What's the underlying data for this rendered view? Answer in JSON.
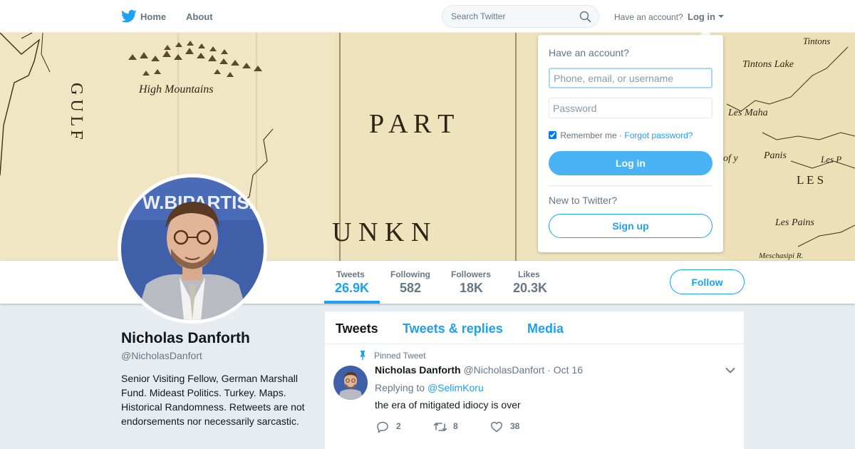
{
  "nav": {
    "logo_icon": "twitter-bird-icon",
    "home_label": "Home",
    "about_label": "About",
    "search_placeholder": "Search Twitter",
    "have_account_label": "Have an account?",
    "login_label": "Log in"
  },
  "banner": {
    "map_labels": [
      "High Mountains",
      "P A R T",
      "U N K N",
      "G U L F",
      "Tintons",
      "Tintons Lake",
      "Les Maha",
      "of y",
      "Panis",
      "Les P",
      "L E S",
      "Les Pains",
      "Meschasipi R."
    ]
  },
  "profile": {
    "name": "Nicholas Danforth",
    "handle": "@NicholasDanfort",
    "bio": "Senior Visiting Fellow, German Marshall Fund. Mideast Politics. Turkey. Maps. Historical Randomness. Retweets are not endorsements nor necessarily sarcastic.",
    "avatar_banner_text": "W.BIPARTISA"
  },
  "stats": [
    {
      "label": "Tweets",
      "value": "26.9K",
      "active": true
    },
    {
      "label": "Following",
      "value": "582",
      "active": false
    },
    {
      "label": "Followers",
      "value": "18K",
      "active": false
    },
    {
      "label": "Likes",
      "value": "20.3K",
      "active": false
    }
  ],
  "follow_label": "Follow",
  "timeline": {
    "tabs": [
      "Tweets",
      "Tweets & replies",
      "Media"
    ],
    "active_tab": "Tweets"
  },
  "tweet": {
    "pinned_label": "Pinned Tweet",
    "fullname": "Nicholas Danforth",
    "username": "@NicholasDanfort",
    "separator": "·",
    "date": "Oct 16",
    "replying_prefix": "Replying to",
    "replying_handle": "@SelimKoru",
    "text": "the era of mitigated idiocy is over",
    "reply_count": "2",
    "retweet_count": "8",
    "like_count": "38"
  },
  "login_dropdown": {
    "title": "Have an account?",
    "username_placeholder": "Phone, email, or username",
    "password_placeholder": "Password",
    "remember_label": "Remember me",
    "separator": "·",
    "forgot_label": "Forgot password?",
    "login_button": "Log in",
    "new_label": "New to Twitter?",
    "signup_button": "Sign up"
  },
  "colors": {
    "accent": "#1da1f2",
    "login_button": "#4ab3f4",
    "background": "#e6ecf0",
    "map_parchment": "#efe3be"
  }
}
